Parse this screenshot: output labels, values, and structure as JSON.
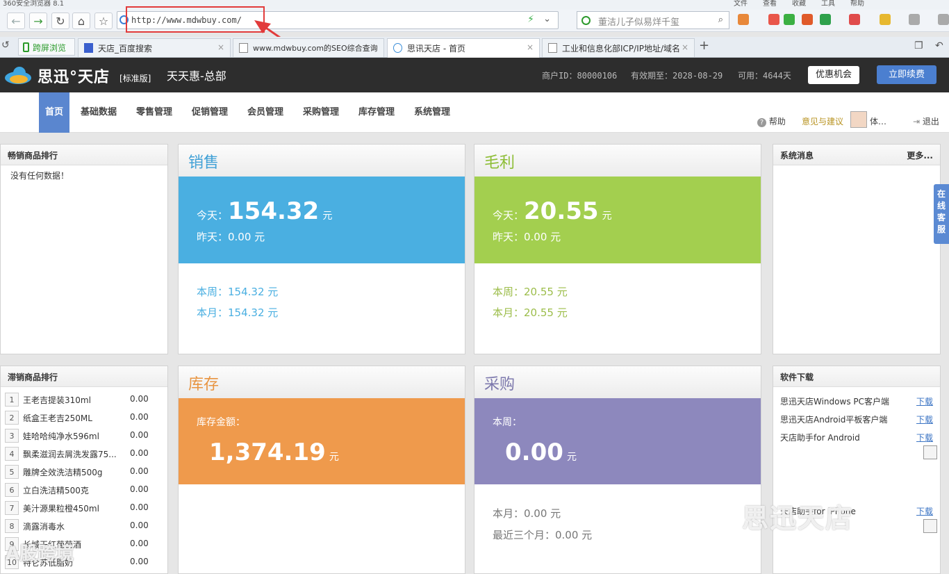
{
  "browser": {
    "title": "360安全浏览器 8.1",
    "menu": [
      "文件",
      "查看",
      "收藏",
      "工具",
      "帮助"
    ],
    "url": "http://www.mdwbuy.com/",
    "search_placeholder": "董洁儿子似易烊千玺",
    "tabs": [
      {
        "label": "跨屏浏览"
      },
      {
        "label": "天店_百度搜索"
      },
      {
        "label": "www.mdwbuy.com的SEO综合查询"
      },
      {
        "label": "思讯天店 - 首页"
      },
      {
        "label": "工业和信息化部ICP/IP地址/域名"
      }
    ],
    "new_tab": "+"
  },
  "app": {
    "brand": "思迅°天店",
    "edition": "[标准版]",
    "store": "天天惠-总部",
    "merchant_id": "商户ID：80000106",
    "valid_until": "有效期至：2028-08-29",
    "available": "可用：4644天",
    "promo_button": "优惠机会",
    "renew_button": "立即续费",
    "nav": [
      "首页",
      "基础数据",
      "零售管理",
      "促销管理",
      "会员管理",
      "采购管理",
      "库存管理",
      "系统管理"
    ],
    "help": "帮助",
    "feedback": "意见与建议",
    "user": "体…",
    "logout": "退出",
    "side_service": "在线客服"
  },
  "bestsellers": {
    "title": "畅销商品排行",
    "empty": "没有任何数据！"
  },
  "sales": {
    "title": "销售",
    "today_label": "今天：",
    "today_value": "154.32",
    "unit": "元",
    "yesterday": "昨天：0.00 元",
    "week": "本周：154.32 元",
    "month": "本月：154.32 元"
  },
  "profit": {
    "title": "毛利",
    "today_label": "今天：",
    "today_value": "20.55",
    "unit": "元",
    "yesterday": "昨天：0.00 元",
    "week": "本周：20.55 元",
    "month": "本月：20.55 元"
  },
  "messages": {
    "title": "系统消息",
    "more": "更多..."
  },
  "slowsellers": {
    "title": "滞销商品排行",
    "items": [
      {
        "rank": "1",
        "name": "王老吉提装310ml",
        "value": "0.00"
      },
      {
        "rank": "2",
        "name": "纸盒王老吉250ML",
        "value": "0.00"
      },
      {
        "rank": "3",
        "name": "娃哈哈纯净水596ml",
        "value": "0.00"
      },
      {
        "rank": "4",
        "name": "飘柔滋润去屑洗发露75...",
        "value": "0.00"
      },
      {
        "rank": "5",
        "name": "雕牌全效洗洁精500g",
        "value": "0.00"
      },
      {
        "rank": "6",
        "name": "立白洗洁精500克",
        "value": "0.00"
      },
      {
        "rank": "7",
        "name": "美汁源果粒橙450ml",
        "value": "0.00"
      },
      {
        "rank": "8",
        "name": "滴露消毒水",
        "value": "0.00"
      },
      {
        "rank": "9",
        "name": "长城干红葡萄酒",
        "value": "0.00"
      },
      {
        "rank": "10",
        "name": "特仑苏低脂奶",
        "value": "0.00"
      }
    ]
  },
  "stock": {
    "title": "库存",
    "label": "库存金额：",
    "value": "1,374.19",
    "unit": "元"
  },
  "purchase": {
    "title": "采购",
    "week_label": "本周：",
    "value": "0.00",
    "unit": "元",
    "month": "本月：0.00 元",
    "quarter": "最近三个月：0.00 元"
  },
  "software": {
    "title": "软件下载",
    "items": [
      {
        "name": "思迅天店Windows PC客户端",
        "link": "下载"
      },
      {
        "name": "思迅天店Android平板客户端",
        "link": "下载"
      },
      {
        "name": "天店助手for Android",
        "link": "下载"
      },
      {
        "name": "天店助手for iPhone",
        "link": "下载"
      }
    ]
  },
  "watermarks": {
    "wm1": "思迅天店",
    "wm2": "A股跨境"
  },
  "colors": {
    "sales": "#4aafe1",
    "profit": "#a3cf4f",
    "stock": "#ef9a4c",
    "purchase": "#8d88bd",
    "nav_active": "#5a86cf"
  }
}
